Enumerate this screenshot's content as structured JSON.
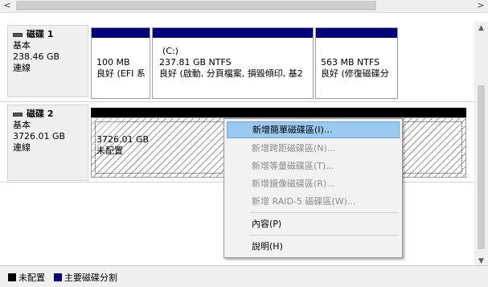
{
  "hscroll": {
    "left_arrow": "<",
    "right_arrow": ">"
  },
  "disks": [
    {
      "name": "磁碟 1",
      "type": "基本",
      "size": "238.46 GB",
      "status": "連線",
      "partitions": [
        {
          "line1": "",
          "line2": "100 MB",
          "line3": "良好 (EFI 系"
        },
        {
          "line1": "(C:)",
          "line2": "237.81 GB NTFS",
          "line3": "良好 (啟動, 分頁檔案, 損毀傾印, 基2"
        },
        {
          "line1": "",
          "line2": "563 MB NTFS",
          "line3": "良好 (修復磁碟分"
        }
      ]
    },
    {
      "name": "磁碟 2",
      "type": "基本",
      "size": "3726.01 GB",
      "status": "連線",
      "unallocated": {
        "size": "3726.01 GB",
        "label": "未配置"
      }
    }
  ],
  "context_menu": {
    "items": [
      {
        "label": "新增簡單磁碟區(I)...",
        "enabled": true,
        "highlighted": true
      },
      {
        "label": "新增跨距磁碟區(N)...",
        "enabled": false
      },
      {
        "label": "新增等量磁碟區(T)...",
        "enabled": false
      },
      {
        "label": "新增鏡像磁碟區(R)...",
        "enabled": false
      },
      {
        "label": "新增 RAID-5 磁碟區(W)...",
        "enabled": false
      },
      {
        "label": "內容(P)",
        "enabled": true
      },
      {
        "label": "說明(H)",
        "enabled": true
      }
    ]
  },
  "legend": [
    {
      "label": "未配置",
      "color": "#000000"
    },
    {
      "label": "主要磁碟分割",
      "color": "#00007f"
    }
  ],
  "colors": {
    "primary_partition": "#00007f",
    "unallocated": "#000000",
    "menu_highlight": "#99c9ef"
  }
}
